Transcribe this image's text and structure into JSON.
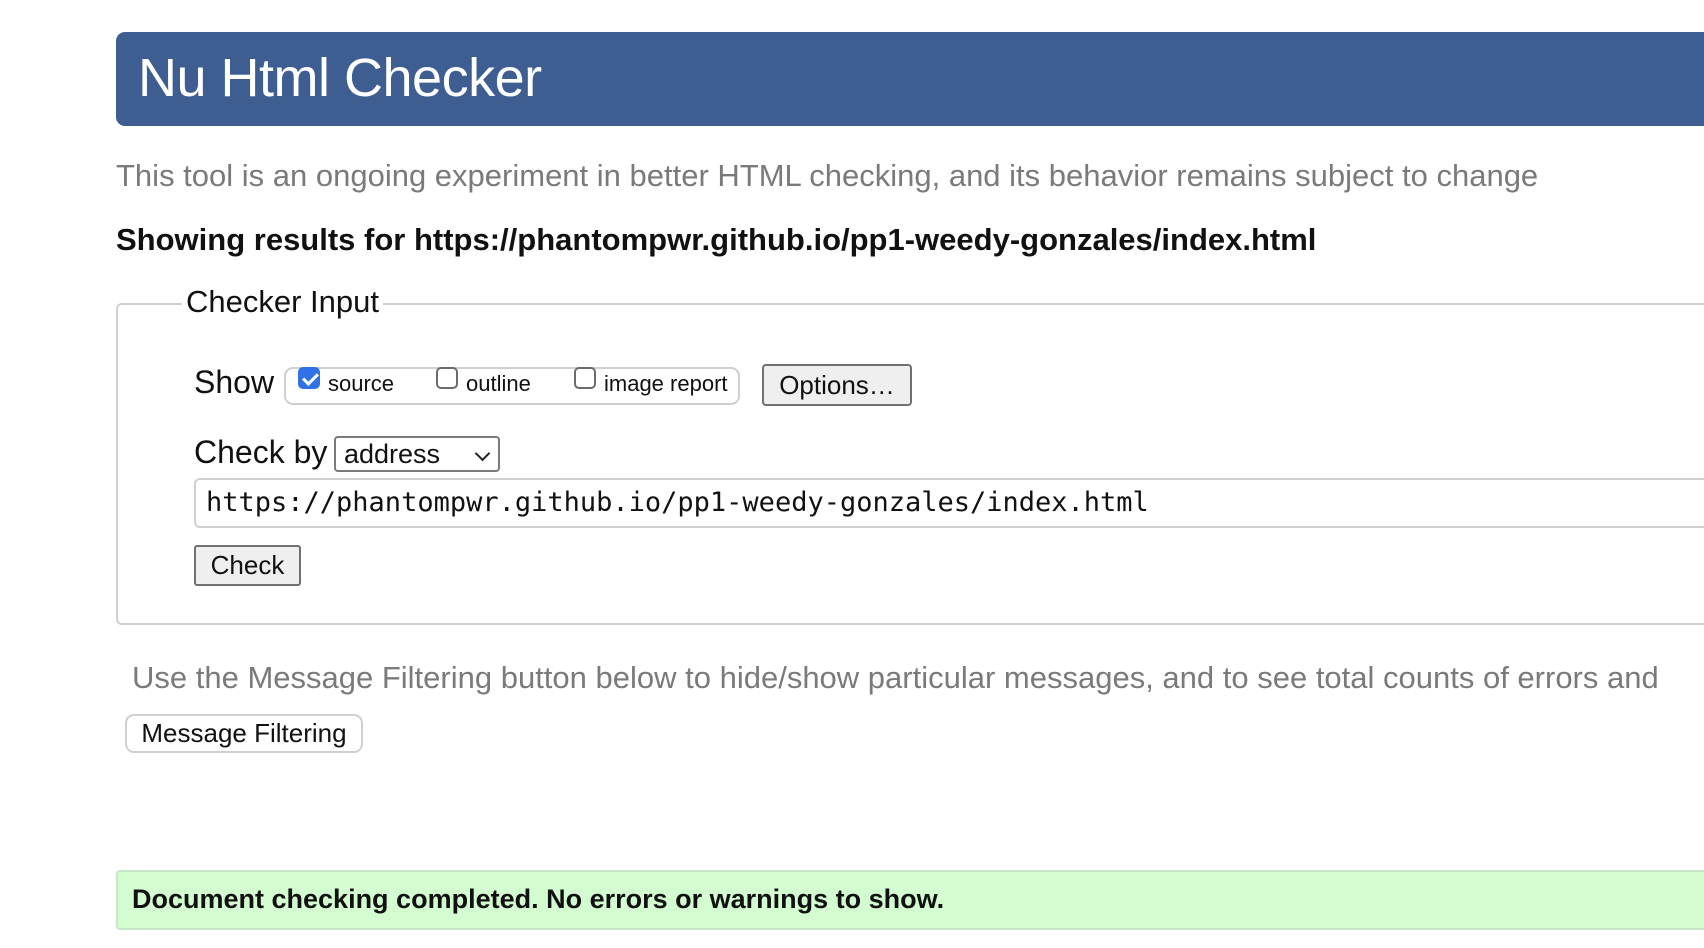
{
  "header": {
    "title": "Nu Html Checker"
  },
  "intro": {
    "text": "This tool is an ongoing experiment in better HTML checking, and its behavior remains subject to change"
  },
  "results": {
    "text": "Showing results for https://phantompwr.github.io/pp1-weedy-gonzales/index.html"
  },
  "checker_input": {
    "legend": "Checker Input",
    "show_label": "Show",
    "show_options": [
      {
        "label": "source",
        "checked": true
      },
      {
        "label": "outline",
        "checked": false
      },
      {
        "label": "image report",
        "checked": false
      }
    ],
    "options_button": "Options…",
    "check_by_label": "Check by",
    "check_by_value": "address",
    "url_value": "https://phantompwr.github.io/pp1-weedy-gonzales/index.html",
    "check_button": "Check"
  },
  "filtering": {
    "text": "Use the Message Filtering button below to hide/show particular messages, and to see total counts of errors and",
    "button": "Message Filtering"
  },
  "status": {
    "text": "Document checking completed. No errors or warnings to show.",
    "color": "#d3fcd0"
  },
  "colors": {
    "header_bg": "#3e5e92",
    "checkbox_accent": "#2f72e5"
  }
}
